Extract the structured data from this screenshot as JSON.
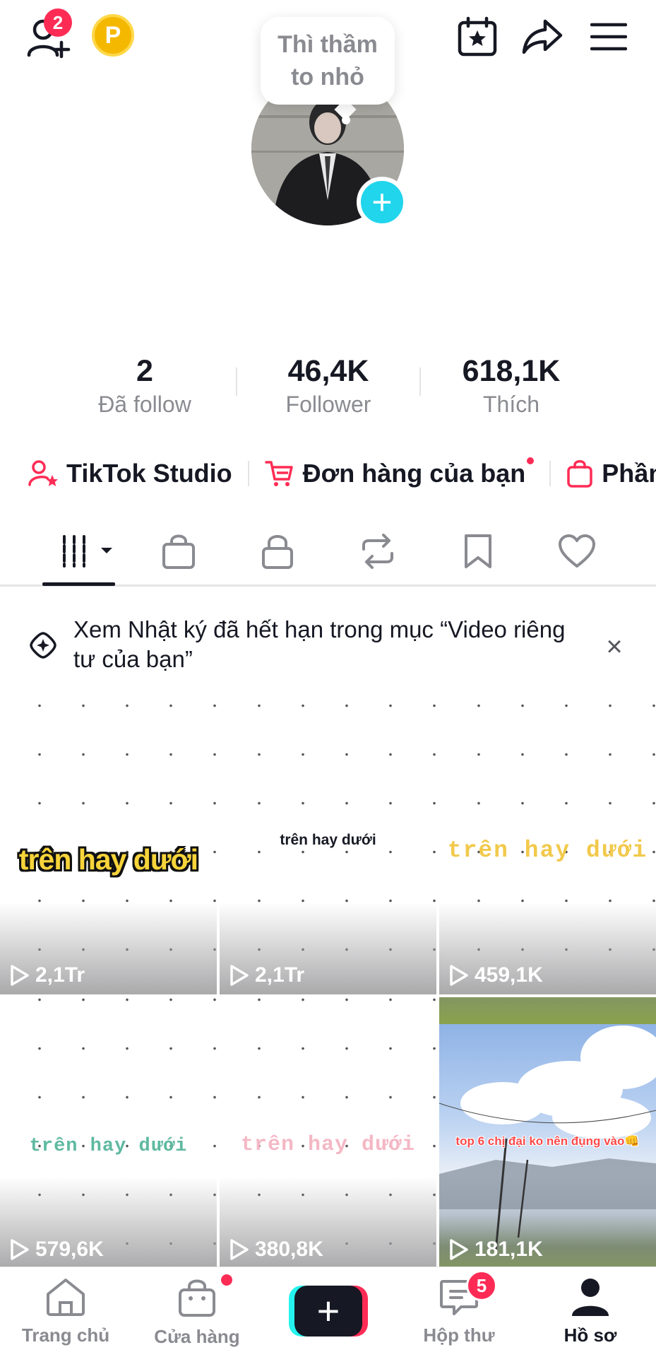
{
  "header": {
    "add_friends_badge": "2",
    "coin_label": "P"
  },
  "profile": {
    "bubble_text_line1": "Thì thầm",
    "bubble_text_line2": "to nhỏ",
    "add_avatar_label": "+"
  },
  "stats": [
    {
      "value": "2",
      "label": "Đã follow"
    },
    {
      "value": "46,4K",
      "label": "Follower"
    },
    {
      "value": "618,1K",
      "label": "Thích"
    }
  ],
  "shortcuts": [
    {
      "label": "TikTok Studio",
      "icon": "person-star-icon"
    },
    {
      "label": "Đơn hàng của bạn",
      "icon": "cart-icon"
    },
    {
      "label": "Phần",
      "icon": "shopping-bag-icon"
    }
  ],
  "tabs": [
    "videos-tab",
    "shop-tab",
    "private-tab",
    "reposts-tab",
    "favorites-tab",
    "liked-tab"
  ],
  "notice": {
    "text": "Xem Nhật ký đã hết hạn trong mục “Video riêng tư của bạn”",
    "close": "×"
  },
  "videos": [
    {
      "caption": "trên hay dưới",
      "views": "2,1Tr"
    },
    {
      "caption": "trên hay dưới",
      "views": "2,1Tr"
    },
    {
      "caption": "trên  hay  dưới",
      "views": "459,1K"
    },
    {
      "caption": "trên hay dưới",
      "views": "579,6K"
    },
    {
      "caption": "trên hay dưới",
      "views": "380,8K"
    },
    {
      "caption": "top 6 chị đại ko nên đụng vào👊",
      "views": "181,1K"
    }
  ],
  "bottom_nav": {
    "home": "Trang chủ",
    "shop": "Cửa hàng",
    "create": "+",
    "inbox": "Hộp thư",
    "inbox_badge": "5",
    "profile": "Hồ sơ"
  },
  "colors": {
    "accent_red": "#fe2c55",
    "accent_cyan": "#25f4ee",
    "text_primary": "#161823",
    "text_secondary": "#8a8b91"
  }
}
